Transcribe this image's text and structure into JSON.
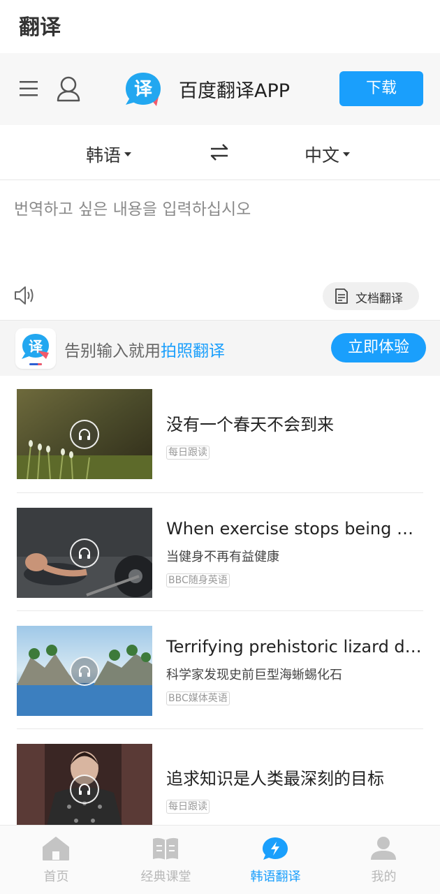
{
  "header": {
    "title": "翻译"
  },
  "appbar": {
    "app_name": "百度翻译APP",
    "download_label": "下载",
    "logo_char": "译"
  },
  "langbar": {
    "source": "韩语",
    "target": "中文"
  },
  "input": {
    "placeholder": "번역하고 싶은 내용을 입력하십시오",
    "doc_translate_label": "文档翻译"
  },
  "promo": {
    "text_prefix": "告别输入就用",
    "text_highlight": "拍照翻译",
    "button_label": "立即体验",
    "logo_char": "译"
  },
  "feed": [
    {
      "title": "没有一个春天不会到来",
      "subtitle": "",
      "tag": "每日跟读"
    },
    {
      "title": "When exercise stops being good for you",
      "subtitle": "当健身不再有益健康",
      "tag": "BBC随身英语"
    },
    {
      "title": "Terrifying prehistoric lizard discovered",
      "subtitle": "科学家发现史前巨型海蜥蜴化石",
      "tag": "BBC媒体英语"
    },
    {
      "title": "追求知识是人类最深刻的目标",
      "subtitle": "",
      "tag": "每日跟读"
    }
  ],
  "tabs": [
    {
      "label": "首页",
      "icon": "home-icon"
    },
    {
      "label": "经典课堂",
      "icon": "book-icon"
    },
    {
      "label": "韩语翻译",
      "icon": "translate-bubble-icon",
      "active": true
    },
    {
      "label": "我的",
      "icon": "person-icon"
    }
  ],
  "colors": {
    "accent": "#1a9ffc",
    "tab_inactive": "#b8b8b8",
    "tag_text": "#999999"
  }
}
